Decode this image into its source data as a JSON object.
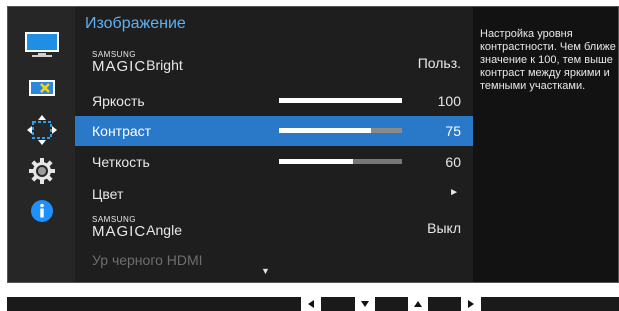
{
  "sidebar": {
    "items": [
      {
        "icon": "picture-icon"
      },
      {
        "icon": "screen-adjust-icon"
      },
      {
        "icon": "position-move-icon"
      },
      {
        "icon": "settings-gear-icon"
      },
      {
        "icon": "information-icon"
      }
    ]
  },
  "menu": {
    "title": "Изображение",
    "rows": [
      {
        "samsung": "SAMSUNG",
        "magic": "MAGIC",
        "suffix": "Bright",
        "value": "Польз."
      },
      {
        "label": "Яркость",
        "value": "100",
        "level": 1.0
      },
      {
        "label": "Контраст",
        "value": "75",
        "level": 0.75
      },
      {
        "label": "Четкость",
        "value": "60",
        "level": 0.6
      },
      {
        "label": "Цвет",
        "arrow": "►"
      },
      {
        "samsung": "SAMSUNG",
        "magic": "MAGIC",
        "suffix": "Angle",
        "value": "Выкл"
      },
      {
        "label": "Ур черного HDMI"
      }
    ],
    "scroll_indicator": "▼"
  },
  "help": {
    "text": "Настройка уровня контрастности. Чем ближе значение к 100, тем выше контраст между яркими и темными участками."
  },
  "navigation": {
    "buttons": [
      "◄",
      "▼",
      "▲",
      "►"
    ]
  },
  "colors": {
    "accent": "#5fb0f2",
    "selected_row": "#2a78c8",
    "info_icon": "#1e90ff"
  }
}
